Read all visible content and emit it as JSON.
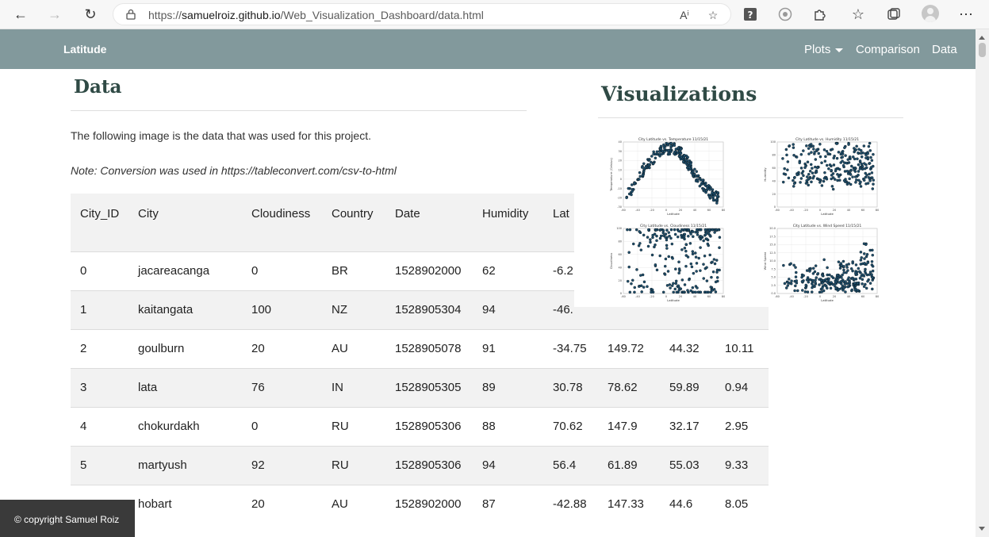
{
  "browser": {
    "url_prefix": "https://",
    "url_host": "samuelroiz.github.io",
    "url_path": "/Web_Visualization_Dashboard/data.html"
  },
  "navbar": {
    "brand": "Latitude",
    "links": [
      "Plots",
      "Comparison",
      "Data"
    ]
  },
  "page": {
    "title": "Data",
    "intro": "The following image is the data that was used for this project.",
    "note": "Note: Conversion was used in https://tableconvert.com/csv-to-html"
  },
  "table": {
    "headers": [
      "City_ID",
      "City",
      "Cloudiness",
      "Country",
      "Date",
      "Humidity",
      "Lat",
      "",
      "",
      ""
    ],
    "rows": [
      [
        "0",
        "jacareacanga",
        "0",
        "BR",
        "1528902000",
        "62",
        "-6.2",
        "",
        "",
        ""
      ],
      [
        "1",
        "kaitangata",
        "100",
        "NZ",
        "1528905304",
        "94",
        "-46.",
        "",
        "",
        ""
      ],
      [
        "2",
        "goulburn",
        "20",
        "AU",
        "1528905078",
        "91",
        "-34.75",
        "149.72",
        "44.32",
        "10.11"
      ],
      [
        "3",
        "lata",
        "76",
        "IN",
        "1528905305",
        "89",
        "30.78",
        "78.62",
        "59.89",
        "0.94"
      ],
      [
        "4",
        "chokurdakh",
        "0",
        "RU",
        "1528905306",
        "88",
        "70.62",
        "147.9",
        "32.17",
        "2.95"
      ],
      [
        "5",
        "martyush",
        "92",
        "RU",
        "1528905306",
        "94",
        "56.4",
        "61.89",
        "55.03",
        "9.33"
      ],
      [
        "",
        "hobart",
        "20",
        "AU",
        "1528902000",
        "87",
        "-42.88",
        "147.33",
        "44.6",
        "8.05"
      ]
    ]
  },
  "visualizations": {
    "title": "Visualizations",
    "plots": [
      {
        "title": "City Latitude vs. Temperature 11/15/21",
        "ylabel": "Temperature (Celsius)",
        "xlabel": "Latitude",
        "yticks": [
          "40",
          "30",
          "20",
          "10",
          "0",
          "-10",
          "-20",
          "-30"
        ],
        "xticks": [
          "-60",
          "-40",
          "-20",
          "0",
          "20",
          "40",
          "60",
          "80"
        ]
      },
      {
        "title": "City Latitude vs. Humidity 11/15/21",
        "ylabel": "Humidity",
        "xlabel": "Latitude",
        "yticks": [
          "100",
          "80",
          "60",
          "40",
          "20",
          "0"
        ],
        "xticks": [
          "-60",
          "-40",
          "-20",
          "0",
          "20",
          "40",
          "60",
          "80"
        ]
      },
      {
        "title": "City Latitude vs. Cloudiness 11/15/21",
        "ylabel": "Cloudiness",
        "xlabel": "Latitude",
        "yticks": [
          "100",
          "80",
          "60",
          "40",
          "20",
          "0"
        ],
        "xticks": [
          "-60",
          "-40",
          "-20",
          "0",
          "20",
          "40",
          "60",
          "80"
        ]
      },
      {
        "title": "City Latitude vs. Wind Speed 11/15/21",
        "ylabel": "Wind Speed",
        "xlabel": "Latitude",
        "yticks": [
          "20.0",
          "17.5",
          "15.0",
          "12.5",
          "10.0",
          "7.5",
          "5.0",
          "2.5",
          "0.0"
        ],
        "xticks": [
          "-60",
          "-40",
          "-20",
          "0",
          "20",
          "40",
          "60",
          "80"
        ]
      }
    ]
  },
  "footer": {
    "text": "© copyright Samuel Roiz"
  },
  "colors": {
    "navbar": "#82999c",
    "heading": "#2f4a45",
    "marker": "#1f4e6b"
  }
}
